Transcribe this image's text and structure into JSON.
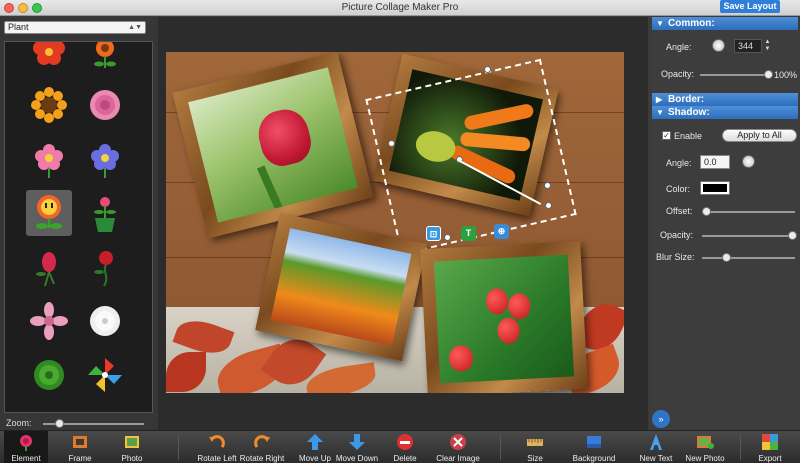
{
  "window": {
    "title": "Picture Collage Maker Pro",
    "save_layout_label": "Save Layout"
  },
  "left_panel": {
    "category_select": "Plant",
    "gallery_items": [
      "red-flower",
      "orange-flower",
      "sunflower",
      "pink-rose",
      "pink-flower",
      "blue-flower",
      "fire-flower",
      "potted-flower",
      "rosebud",
      "red-rose-sketch",
      "pink-blossom",
      "dandelion",
      "green-spiky-plant",
      "pinwheel-flower"
    ],
    "selected_item": "fire-flower",
    "zoom_label": "Zoom:"
  },
  "right_panel": {
    "common": {
      "title": "Common:",
      "angle_label": "Angle:",
      "angle_value": "344",
      "opacity_label": "Opacity:",
      "opacity_value": "100%",
      "opacity_fraction": 1.0
    },
    "border": {
      "title": "Border:"
    },
    "shadow": {
      "title": "Shadow:",
      "enable_label": "Enable",
      "enable_checked": true,
      "apply_to_all_label": "Apply to All",
      "angle_label": "Angle:",
      "angle_value": "0.0",
      "color_label": "Color:",
      "color_value": "#000000",
      "offset_label": "Offset:",
      "offset_fraction": 0.0,
      "opacity_label": "Opacity:",
      "opacity_fraction": 1.0,
      "blur_label": "Blur Size:",
      "blur_fraction": 0.27
    }
  },
  "toolbar": [
    {
      "label": "Element",
      "icon": "rose-icon",
      "active": true
    },
    {
      "label": "Frame",
      "icon": "frame-icon"
    },
    {
      "label": "Photo",
      "icon": "photo-icon"
    },
    {
      "label": "Rotate Left",
      "icon": "rotate-left-icon"
    },
    {
      "label": "Rotate Right",
      "icon": "rotate-right-icon"
    },
    {
      "label": "Move Up",
      "icon": "arrow-up-icon"
    },
    {
      "label": "Move Down",
      "icon": "arrow-down-icon"
    },
    {
      "label": "Delete",
      "icon": "delete-icon"
    },
    {
      "label": "Clear Image",
      "icon": "clear-image-icon"
    },
    {
      "label": "Size",
      "icon": "size-icon"
    },
    {
      "label": "Background",
      "icon": "background-icon"
    },
    {
      "label": "New Text",
      "icon": "new-text-icon"
    },
    {
      "label": "New Photo",
      "icon": "new-photo-icon"
    },
    {
      "label": "Export",
      "icon": "export-icon"
    }
  ],
  "colors": {
    "accent": "#2f74c6",
    "section_header": "#3a7bc8",
    "panel_bg": "#3d3d3d"
  }
}
